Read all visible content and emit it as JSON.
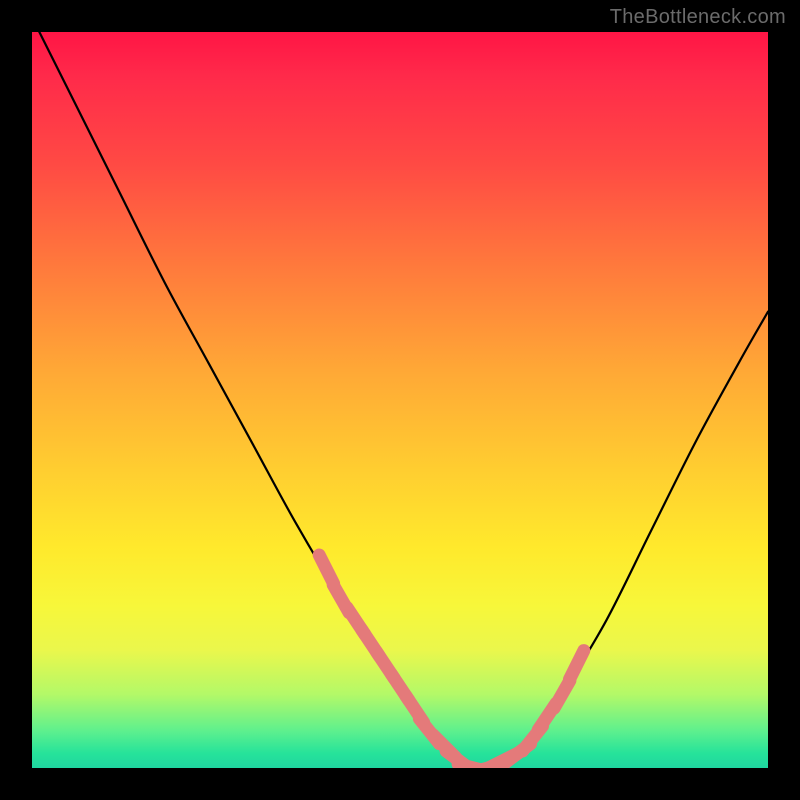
{
  "watermark": "TheBottleneck.com",
  "colors": {
    "curve_stroke": "#000000",
    "marker_fill": "#e47a7a",
    "marker_stroke": "#d86b6b",
    "background": "#000000"
  },
  "chart_data": {
    "type": "line",
    "title": "",
    "xlabel": "",
    "ylabel": "",
    "xlim": [
      0,
      100
    ],
    "ylim": [
      0,
      100
    ],
    "grid": false,
    "legend": false,
    "series": [
      {
        "name": "bottleneck-curve",
        "x": [
          0,
          6,
          12,
          18,
          24,
          30,
          36,
          42,
          48,
          52,
          56,
          58,
          60,
          64,
          68,
          72,
          78,
          84,
          90,
          96,
          100
        ],
        "y": [
          102,
          90,
          78,
          66,
          55,
          44,
          33,
          23,
          14,
          8,
          3,
          1,
          0,
          1,
          4,
          10,
          20,
          32,
          44,
          55,
          62
        ]
      }
    ],
    "markers": {
      "name": "highlighted-points",
      "x": [
        40,
        42,
        44,
        46,
        48,
        50,
        52,
        54,
        56,
        58,
        60,
        62,
        64,
        66,
        68,
        70,
        72,
        74
      ],
      "y": [
        27,
        23,
        20,
        17,
        14,
        11,
        8,
        5,
        3,
        1,
        0,
        0,
        1,
        2,
        4,
        7,
        10,
        14
      ]
    }
  }
}
